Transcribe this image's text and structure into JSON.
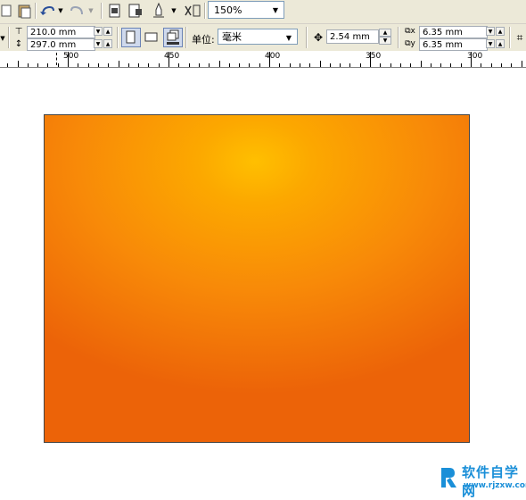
{
  "toolbar": {
    "zoom_value": "150%"
  },
  "property_bar": {
    "width_value": "210.0 mm",
    "height_value": "297.0 mm",
    "units_label": "单位:",
    "units_value": "毫米",
    "nudge_value": "2.54 mm",
    "dup_x_value": "6.35 mm",
    "dup_y_value": "6.35 mm"
  },
  "ruler": {
    "labels": [
      "500",
      "450",
      "400",
      "350",
      "300"
    ]
  },
  "canvas": {
    "fill_colors": {
      "center": "#ffbf00",
      "edge": "#ec6308"
    }
  },
  "watermark": {
    "text": "软件自学网",
    "url": "www.rjzxw.com"
  }
}
